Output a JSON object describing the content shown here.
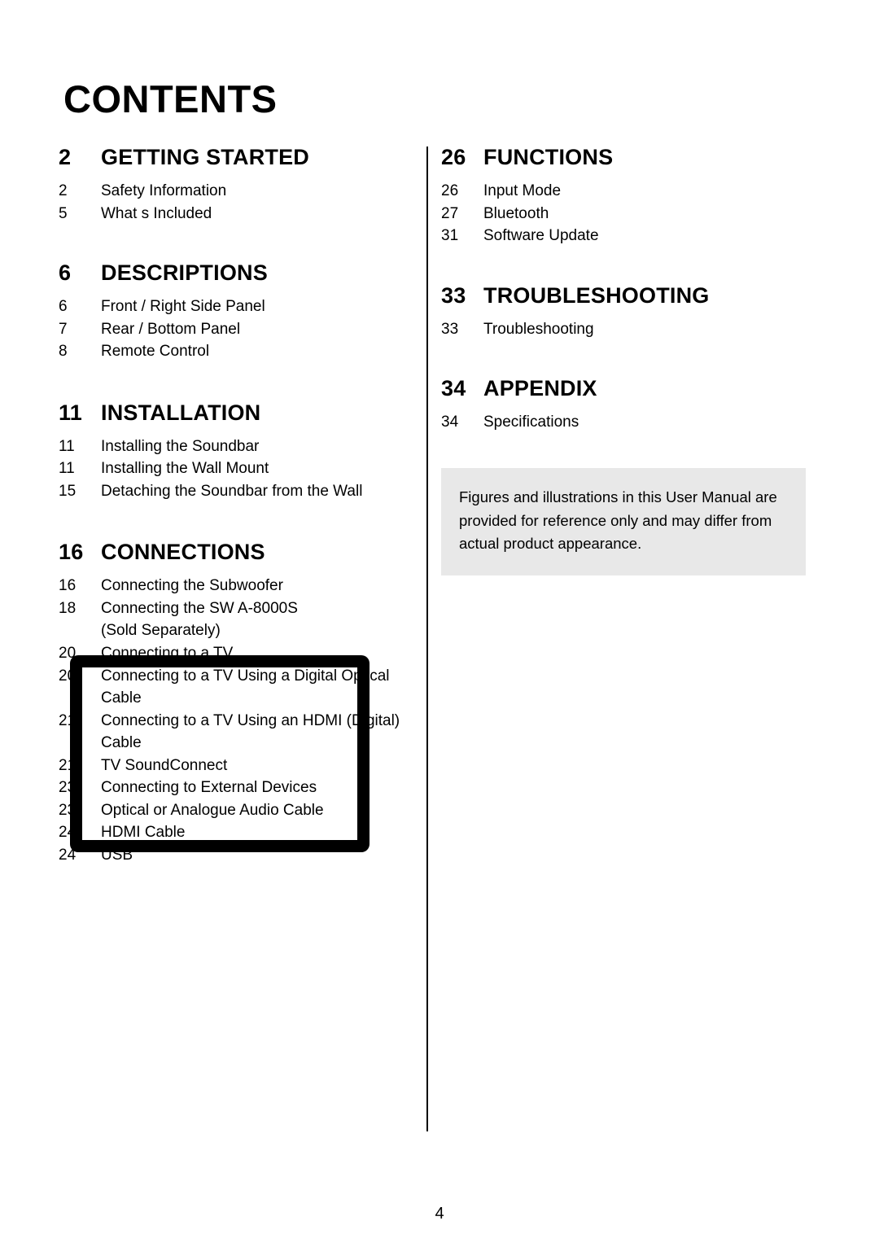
{
  "document": {
    "title": "CONTENTS",
    "page_number": "4"
  },
  "left_column": [
    {
      "section_number": "2",
      "section_title": "GETTING STARTED",
      "entries": [
        {
          "num": "2",
          "label": "Safety Information"
        },
        {
          "num": "5",
          "label": "What s Included"
        }
      ]
    },
    {
      "section_number": "6",
      "section_title": "DESCRIPTIONS",
      "entries": [
        {
          "num": "6",
          "label": "Front / Right Side Panel"
        },
        {
          "num": "7",
          "label": "Rear / Bottom Panel"
        },
        {
          "num": "8",
          "label": "Remote Control"
        }
      ]
    },
    {
      "section_number": "11",
      "section_title": "INSTALLATION",
      "entries": [
        {
          "num": "11",
          "label": "Installing the Soundbar"
        },
        {
          "num": "11",
          "label": "Installing the Wall Mount"
        },
        {
          "num": "15",
          "label": "Detaching the Soundbar from the Wall"
        }
      ]
    },
    {
      "section_number": "16",
      "section_title": "CONNECTIONS",
      "entries": [
        {
          "num": "16",
          "label": "Connecting the Subwoofer"
        },
        {
          "num": "18",
          "label": "Connecting the SW  A-8000S",
          "sub": "(Sold Separately)"
        },
        {
          "num": "20",
          "label": "Connecting to a TV"
        },
        {
          "num": "20",
          "label": "Connecting to a TV Using a Digital Optical",
          "sub": "Cable"
        },
        {
          "num": "21",
          "label": "Connecting to a TV Using an HDMI (Digital)",
          "sub": "Cable"
        },
        {
          "num": "21",
          "label": "TV SoundConnect"
        },
        {
          "num": "23",
          "label": "Connecting to External Devices"
        },
        {
          "num": "23",
          "label": "Optical or Analogue Audio Cable"
        },
        {
          "num": "24",
          "label": "HDMI Cable"
        },
        {
          "num": "24",
          "label": "USB"
        }
      ]
    }
  ],
  "right_column": [
    {
      "section_number": "26",
      "section_title": "FUNCTIONS",
      "entries": [
        {
          "num": "26",
          "label": "Input Mode"
        },
        {
          "num": "27",
          "label": "Bluetooth"
        },
        {
          "num": "31",
          "label": "Software Update"
        }
      ]
    },
    {
      "section_number": "33",
      "section_title": "TROUBLESHOOTING",
      "entries": [
        {
          "num": "33",
          "label": "Troubleshooting"
        }
      ]
    },
    {
      "section_number": "34",
      "section_title": "APPENDIX",
      "entries": [
        {
          "num": "34",
          "label": "Specifications"
        }
      ]
    }
  ],
  "note": {
    "text": "Figures and illustrations in this User Manual are provided for reference only and may differ from actual product appearance."
  },
  "colors": {
    "note_background": "#e8e8e8",
    "text": "#000000",
    "highlight_border": "#000000"
  }
}
